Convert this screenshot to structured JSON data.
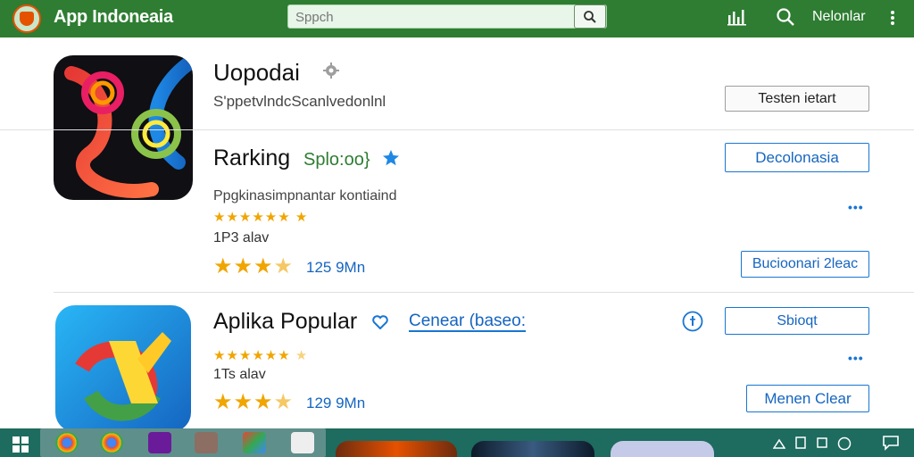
{
  "header": {
    "title": "App Indoneaia",
    "search_placeholder": "Sppch",
    "user": "Nelonlar"
  },
  "rows": [
    {
      "title": "Uopodai",
      "subtitle": "S'ppetvlndcScanlvedonlnl",
      "button": "Testen ietart"
    },
    {
      "title": "Rarking",
      "tag": "Splo:oo}",
      "description": "Ppgkinasimpnantar kontiaind",
      "size": "1P3 alav",
      "rating_text": "125 9Mn",
      "rating": 3.5,
      "button_primary": "Decolonasia",
      "button_secondary": "Bucioonari 2leac",
      "more": "•••"
    },
    {
      "title": "Aplika Popular",
      "link": "Cenear (baseo:",
      "size": "1Ts alav",
      "rating_text": "129 9Mn",
      "rating": 3.5,
      "button_primary": "Sbioqt",
      "button_secondary": "Menen Clear",
      "more": "•••"
    }
  ],
  "colors": {
    "header": "#2e7d32",
    "accent": "#1976d2",
    "star": "#f0a500",
    "taskbar": "#1e6b5f"
  },
  "icons": [
    "app-logo-icon",
    "search-icon",
    "bar-chart-icon",
    "more-vert-icon",
    "settings-gear-icon",
    "star-icon",
    "heart-icon",
    "info-icon"
  ]
}
